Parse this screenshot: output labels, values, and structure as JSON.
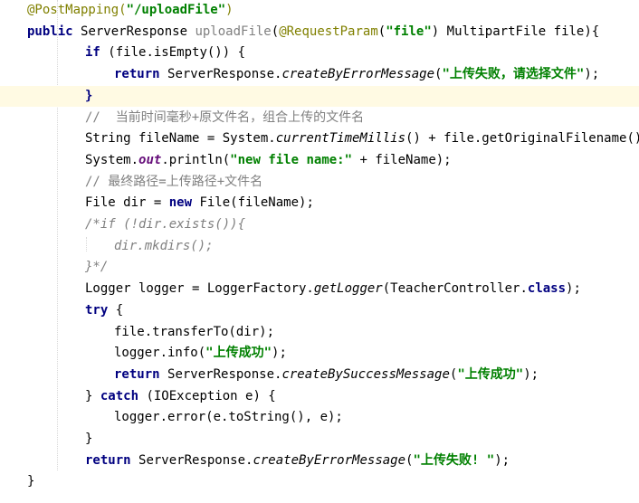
{
  "editor": {
    "lines": [
      [
        {
          "t": "@PostMapping(",
          "c": "ann"
        },
        {
          "t": "\"/uploadFile\"",
          "c": "str"
        },
        {
          "t": ")",
          "c": "ann"
        }
      ],
      [
        {
          "t": "public ",
          "c": "kw"
        },
        {
          "t": "ServerResponse ",
          "c": ""
        },
        {
          "t": "uploadFile",
          "c": "unused"
        },
        {
          "t": "(",
          "c": ""
        },
        {
          "t": "@RequestParam",
          "c": "ann"
        },
        {
          "t": "(",
          "c": ""
        },
        {
          "t": "\"file\"",
          "c": "str"
        },
        {
          "t": ") MultipartFile file){",
          "c": ""
        }
      ],
      [
        {
          "t": "if ",
          "c": "kw"
        },
        {
          "t": "(file.isEmpty()) {",
          "c": ""
        }
      ],
      [
        {
          "t": "return ",
          "c": "kw"
        },
        {
          "t": "ServerResponse.",
          "c": ""
        },
        {
          "t": "createByErrorMessage",
          "c": "it"
        },
        {
          "t": "(",
          "c": ""
        },
        {
          "t": "\"上传失败，请选择文件\"",
          "c": "str"
        },
        {
          "t": ");",
          "c": ""
        }
      ],
      [
        {
          "t": "}",
          "c": "kw"
        }
      ],
      [
        {
          "t": "//  当前时间毫秒+原文件名，组合上传的文件名",
          "c": "cmt-plain"
        }
      ],
      [
        {
          "t": "String fileName = System.",
          "c": ""
        },
        {
          "t": "currentTimeMillis",
          "c": "it"
        },
        {
          "t": "() + file.getOriginalFilename();",
          "c": ""
        }
      ],
      [
        {
          "t": "System.",
          "c": ""
        },
        {
          "t": "out",
          "c": "field"
        },
        {
          "t": ".println(",
          "c": ""
        },
        {
          "t": "\"new file name:\"",
          "c": "str"
        },
        {
          "t": " + fileName);",
          "c": ""
        }
      ],
      [
        {
          "t": "// 最终路径=上传路径+文件名",
          "c": "cmt-plain"
        }
      ],
      [
        {
          "t": "File dir = ",
          "c": ""
        },
        {
          "t": "new ",
          "c": "kw"
        },
        {
          "t": "File(fileName);",
          "c": ""
        }
      ],
      [
        {
          "t": "/*if (!dir.exists()){",
          "c": "cmt"
        }
      ],
      [
        {
          "t": "dir.mkdirs();",
          "c": "cmt"
        }
      ],
      [
        {
          "t": "}*/",
          "c": "cmt"
        }
      ],
      [
        {
          "t": "Logger logger = LoggerFactory.",
          "c": ""
        },
        {
          "t": "getLogger",
          "c": "it"
        },
        {
          "t": "(TeacherController.",
          "c": ""
        },
        {
          "t": "class",
          "c": "kw"
        },
        {
          "t": ");",
          "c": ""
        }
      ],
      [
        {
          "t": "try ",
          "c": "kw"
        },
        {
          "t": "{",
          "c": ""
        }
      ],
      [
        {
          "t": "file.transferTo(dir);",
          "c": ""
        }
      ],
      [
        {
          "t": "logger.info(",
          "c": ""
        },
        {
          "t": "\"上传成功\"",
          "c": "str"
        },
        {
          "t": ");",
          "c": ""
        }
      ],
      [
        {
          "t": "return ",
          "c": "kw"
        },
        {
          "t": "ServerResponse.",
          "c": ""
        },
        {
          "t": "createBySuccessMessage",
          "c": "it"
        },
        {
          "t": "(",
          "c": ""
        },
        {
          "t": "\"上传成功\"",
          "c": "str"
        },
        {
          "t": ");",
          "c": ""
        }
      ],
      [
        {
          "t": "} ",
          "c": ""
        },
        {
          "t": "catch ",
          "c": "kw"
        },
        {
          "t": "(IOException e) {",
          "c": ""
        }
      ],
      [
        {
          "t": "logger.error(e.toString(), e);",
          "c": ""
        }
      ],
      [
        {
          "t": "}",
          "c": ""
        }
      ],
      [
        {
          "t": "return ",
          "c": "kw"
        },
        {
          "t": "ServerResponse.",
          "c": ""
        },
        {
          "t": "createByErrorMessage",
          "c": "it"
        },
        {
          "t": "(",
          "c": ""
        },
        {
          "t": "\"上传失败! \"",
          "c": "str"
        },
        {
          "t": ");",
          "c": ""
        }
      ],
      [
        {
          "t": "}",
          "c": ""
        }
      ]
    ],
    "highlighted_line": 4,
    "indents": [
      0,
      1,
      2,
      3,
      2,
      2,
      2,
      2,
      2,
      2,
      2,
      3,
      2,
      2,
      2,
      3,
      3,
      3,
      2,
      3,
      2,
      2,
      1
    ]
  },
  "colors": {
    "annotation": "#808000",
    "keyword": "#000080",
    "string": "#008000",
    "comment": "#808080",
    "static_field": "#660e7a",
    "current_line": "#fffae3"
  }
}
